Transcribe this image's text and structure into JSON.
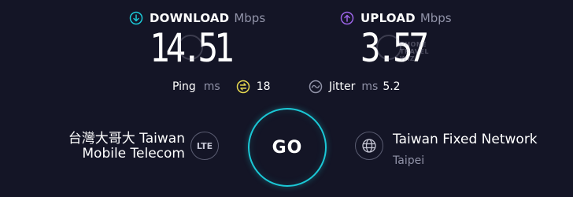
{
  "download": {
    "title": "DOWNLOAD",
    "unit": "Mbps",
    "value": "14.51",
    "icon": "download-arrow-icon",
    "color": "#1bc8d6"
  },
  "upload": {
    "title": "UPLOAD",
    "unit": "Mbps",
    "value": "3.57",
    "icon": "upload-arrow-icon",
    "color": "#9b63e6"
  },
  "watermark": {
    "line1": "PHONE",
    "line2": "TRAVEL",
    "line3": "WIZ"
  },
  "ping": {
    "label": "Ping",
    "unit": "ms",
    "value": "18",
    "icon": "ping-icon",
    "color": "#e6d84f"
  },
  "jitter": {
    "label": "Jitter",
    "unit": "ms",
    "value": "5.2",
    "icon": "jitter-icon"
  },
  "isp": {
    "line1": "台灣大哥大 Taiwan",
    "line2": "Mobile Telecom",
    "connection_type": "LTE"
  },
  "go": {
    "label": "GO"
  },
  "server": {
    "name": "Taiwan Fixed Network",
    "location": "Taipei",
    "icon": "globe-icon"
  }
}
